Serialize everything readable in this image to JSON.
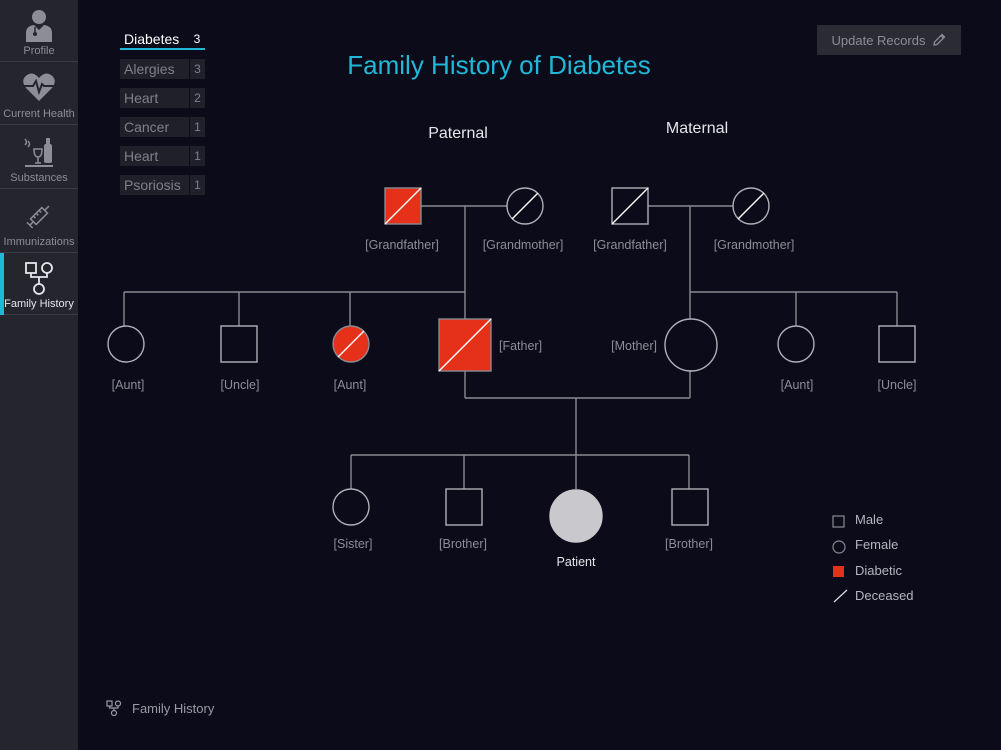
{
  "sidebar": {
    "items": [
      {
        "label": "Profile",
        "icon": "doctor-icon"
      },
      {
        "label": "Current Health",
        "icon": "heart-pulse-icon"
      },
      {
        "label": "Substances",
        "icon": "substances-icon"
      },
      {
        "label": "Immunizations",
        "icon": "syringe-icon"
      },
      {
        "label": "Family History",
        "icon": "family-tree-icon",
        "active": true
      }
    ]
  },
  "conditions": [
    {
      "label": "Diabetes",
      "count": "3",
      "active": true
    },
    {
      "label": "Alergies",
      "count": "3"
    },
    {
      "label": "Heart",
      "count": "2"
    },
    {
      "label": "Cancer",
      "count": "1"
    },
    {
      "label": "Heart",
      "count": "1"
    },
    {
      "label": "Psoriosis",
      "count": "1"
    }
  ],
  "update_button": {
    "label": "Update Records"
  },
  "title": "Family History of Diabetes",
  "sides": {
    "paternal": "Paternal",
    "maternal": "Maternal"
  },
  "members": {
    "p_grandfather": {
      "label": "[Grandfather]",
      "sex": "male",
      "diabetic": true,
      "deceased": true
    },
    "p_grandmother": {
      "label": "[Grandmother]",
      "sex": "female",
      "diabetic": false,
      "deceased": true
    },
    "m_grandfather": {
      "label": "[Grandfather]",
      "sex": "male",
      "diabetic": false,
      "deceased": true
    },
    "m_grandmother": {
      "label": "[Grandmother]",
      "sex": "female",
      "diabetic": false,
      "deceased": true
    },
    "p_aunt1": {
      "label": "[Aunt]",
      "sex": "female",
      "diabetic": false,
      "deceased": false
    },
    "p_uncle": {
      "label": "[Uncle]",
      "sex": "male",
      "diabetic": false,
      "deceased": false
    },
    "p_aunt2": {
      "label": "[Aunt]",
      "sex": "female",
      "diabetic": true,
      "deceased": true
    },
    "father": {
      "label": "[Father]",
      "sex": "male",
      "diabetic": true,
      "deceased": true
    },
    "mother": {
      "label": "[Mother]",
      "sex": "female",
      "diabetic": false,
      "deceased": false
    },
    "m_aunt": {
      "label": "[Aunt]",
      "sex": "female",
      "diabetic": false,
      "deceased": false
    },
    "m_uncle": {
      "label": "[Uncle]",
      "sex": "male",
      "diabetic": false,
      "deceased": false
    },
    "sister": {
      "label": "[Sister]",
      "sex": "female",
      "diabetic": false,
      "deceased": false
    },
    "brother1": {
      "label": "[Brother]",
      "sex": "male",
      "diabetic": false,
      "deceased": false
    },
    "patient": {
      "label": "Patient",
      "sex": "female",
      "diabetic": false,
      "deceased": false
    },
    "brother2": {
      "label": "[Brother]",
      "sex": "male",
      "diabetic": false,
      "deceased": false
    }
  },
  "legend": {
    "male": "Male",
    "female": "Female",
    "diabetic": "Diabetic",
    "deceased": "Deceased"
  },
  "colors": {
    "accent": "#21b7d6",
    "diabetic": "#e5311a",
    "line": "#8a8a92",
    "patient_fill": "#c8c8cd"
  },
  "footer": {
    "label": "Family History",
    "icon": "family-tree-icon"
  }
}
